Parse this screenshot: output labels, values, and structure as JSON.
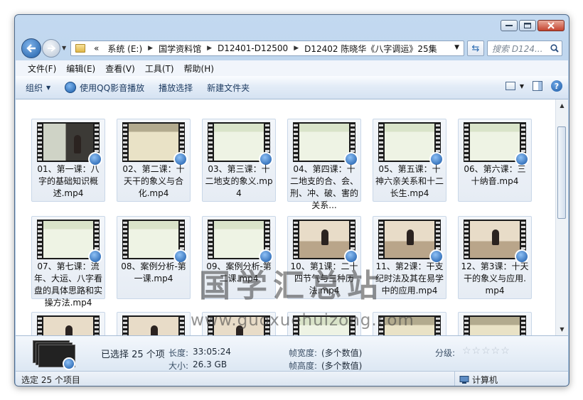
{
  "address": {
    "crumbs": [
      "系统 (E:)",
      "国学资料馆",
      "D12401-D12500",
      "D12402 陈晓华《八字调运》25集"
    ],
    "lead_chevrons": "«"
  },
  "search": {
    "placeholder": "搜索 D124..."
  },
  "menu": [
    "文件(F)",
    "编辑(E)",
    "查看(V)",
    "工具(T)",
    "帮助(H)"
  ],
  "toolbar": {
    "organize": "组织",
    "play_qq": "使用QQ影音播放",
    "play_select": "播放选择",
    "new_folder": "新建文件夹"
  },
  "files": [
    {
      "name": "01、第一课：八字的基础知识概述.mp4",
      "scene": "classroom"
    },
    {
      "name": "02、第二课：十天干的象义与合化.mp4",
      "scene": "title"
    },
    {
      "name": "03、第三课：十二地支的象义.mp4",
      "scene": "slide"
    },
    {
      "name": "04、第四课：十二地支的合、会、刑、冲、破、害的关系...",
      "scene": "slide"
    },
    {
      "name": "05、第五课：十神六亲关系和十二长生.mp4",
      "scene": "slide"
    },
    {
      "name": "06、第六课：三十纳音.mp4",
      "scene": "slide"
    },
    {
      "name": "07、第七课：流年、大运、八字看盘的具体思路和实操方法.mp4",
      "scene": "slide"
    },
    {
      "name": "08、案例分析-第一课.mp4",
      "scene": "slide"
    },
    {
      "name": "09、案例分析-第二课.mp4",
      "scene": "slide"
    },
    {
      "name": "10、第1课：二十四节气与三种历法.mp4",
      "scene": "room"
    },
    {
      "name": "11、第2课：干支纪时法及其在易学中的应用.mp4",
      "scene": "room"
    },
    {
      "name": "12、第3课：十天干的象义与应用.mp4",
      "scene": "room"
    },
    {
      "name": "",
      "scene": "room"
    },
    {
      "name": "",
      "scene": "room"
    },
    {
      "name": "",
      "scene": "room"
    },
    {
      "name": "",
      "scene": "slide"
    },
    {
      "name": "",
      "scene": "title"
    },
    {
      "name": "",
      "scene": "title"
    }
  ],
  "details": {
    "selected": "已选择 25 个项",
    "length_label": "长度:",
    "length_value": "33:05:24",
    "size_label": "大小:",
    "size_value": "26.3 GB",
    "frame_width_label": "帧宽度:",
    "frame_width_value": "(多个数值)",
    "frame_height_label": "帧高度:",
    "frame_height_value": "(多个数值)",
    "rating_label": "分级:",
    "rating_stars": "☆☆☆☆☆"
  },
  "status": {
    "left": "选定 25 个项目",
    "right": "计算机"
  },
  "watermark": {
    "line1": "国学汇总站",
    "line2": "www.guoxuehuizong.com"
  }
}
